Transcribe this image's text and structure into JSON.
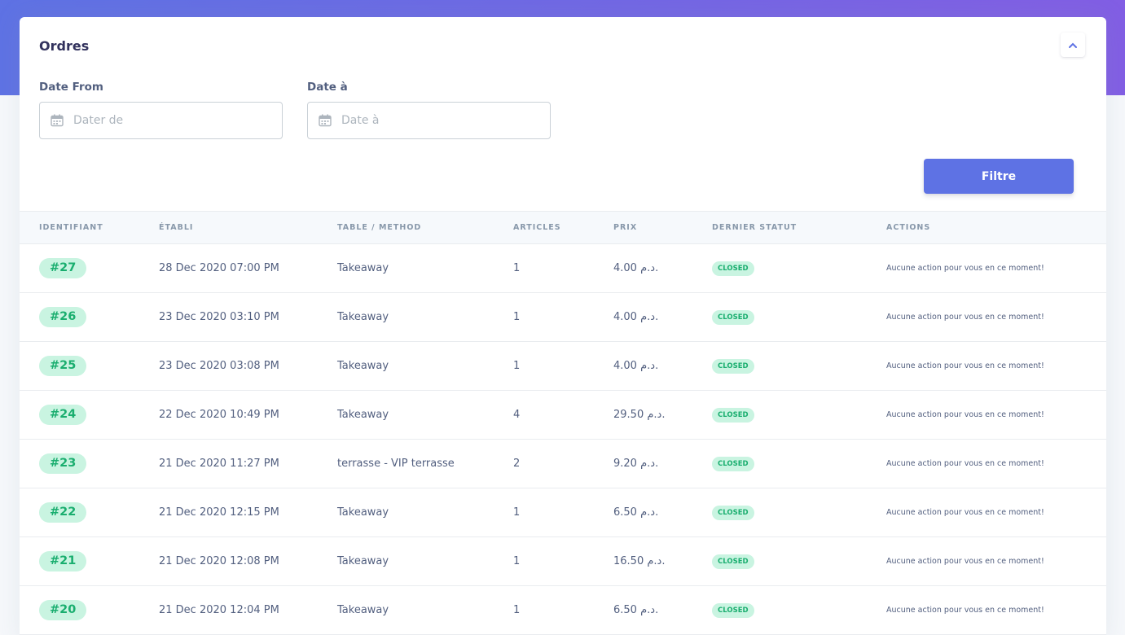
{
  "card": {
    "title": "Ordres",
    "collapse_icon": "chevron-up-icon"
  },
  "filters": {
    "date_from": {
      "label": "Date From",
      "placeholder": "Dater de",
      "value": ""
    },
    "date_to": {
      "label": "Date à",
      "placeholder": "Date à",
      "value": ""
    },
    "submit_label": "Filtre"
  },
  "table": {
    "headers": [
      "Identifiant",
      "Établi",
      "Table / method",
      "Articles",
      "Prix",
      "Dernier statut",
      "Actions"
    ],
    "rows": [
      {
        "id": "#27",
        "created": "28 Dec 2020 07:00 PM",
        "method": "Takeaway",
        "items": "1",
        "price": "4.00 د.م.",
        "status": "closed",
        "action": "Aucune action pour vous en ce moment!"
      },
      {
        "id": "#26",
        "created": "23 Dec 2020 03:10 PM",
        "method": "Takeaway",
        "items": "1",
        "price": "4.00 د.م.",
        "status": "closed",
        "action": "Aucune action pour vous en ce moment!"
      },
      {
        "id": "#25",
        "created": "23 Dec 2020 03:08 PM",
        "method": "Takeaway",
        "items": "1",
        "price": "4.00 د.م.",
        "status": "closed",
        "action": "Aucune action pour vous en ce moment!"
      },
      {
        "id": "#24",
        "created": "22 Dec 2020 10:49 PM",
        "method": "Takeaway",
        "items": "4",
        "price": "29.50 د.م.",
        "status": "closed",
        "action": "Aucune action pour vous en ce moment!"
      },
      {
        "id": "#23",
        "created": "21 Dec 2020 11:27 PM",
        "method": "terrasse - VIP terrasse",
        "items": "2",
        "price": "9.20 د.م.",
        "status": "closed",
        "action": "Aucune action pour vous en ce moment!"
      },
      {
        "id": "#22",
        "created": "21 Dec 2020 12:15 PM",
        "method": "Takeaway",
        "items": "1",
        "price": "6.50 د.م.",
        "status": "closed",
        "action": "Aucune action pour vous en ce moment!"
      },
      {
        "id": "#21",
        "created": "21 Dec 2020 12:08 PM",
        "method": "Takeaway",
        "items": "1",
        "price": "16.50 د.م.",
        "status": "closed",
        "action": "Aucune action pour vous en ce moment!"
      },
      {
        "id": "#20",
        "created": "21 Dec 2020 12:04 PM",
        "method": "Takeaway",
        "items": "1",
        "price": "6.50 د.م.",
        "status": "closed",
        "action": "Aucune action pour vous en ce moment!"
      }
    ]
  },
  "colors": {
    "primary": "#5e72e4",
    "gradient_end": "#825ee4",
    "success_bg": "#c9f4e1",
    "success_text": "#1aae6f"
  }
}
